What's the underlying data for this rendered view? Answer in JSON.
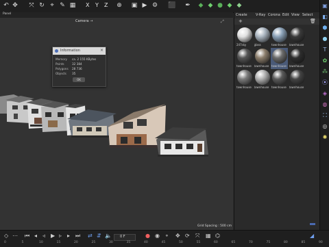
{
  "viewport": {
    "menu_label": "Panel",
    "camera_label": "Camera →",
    "grid_spacing": "Grid Spacing : 500 cm"
  },
  "toolbar": {
    "axis_x": "X",
    "axis_y": "Y",
    "axis_z": "Z"
  },
  "info_dialog": {
    "title": "Information",
    "rows": [
      {
        "label": "Memory",
        "value": "ca. 2 155 KBytes"
      },
      {
        "label": "Points",
        "value": "32 384"
      },
      {
        "label": "Polygons",
        "value": "28 736"
      },
      {
        "label": "Objects",
        "value": "35"
      }
    ],
    "ok_label": "OK"
  },
  "material_panel": {
    "menu": [
      "Create",
      "V-Ray",
      "Corona",
      "Edit",
      "View",
      "Select"
    ],
    "materials": [
      {
        "label": "247sky",
        "color": "#e0e0e0"
      },
      {
        "label": "glass",
        "color": "#a9b4bf"
      },
      {
        "label": "townhouse",
        "color": "#8aa0b6"
      },
      {
        "label": "townhouse",
        "color": "#3a3a3a"
      },
      {
        "label": "townhouse",
        "color": "#555555"
      },
      {
        "label": "townhouse",
        "color": "#8b7d6b"
      },
      {
        "label": "townhouse",
        "color": "#6b6b6b"
      },
      {
        "label": "townhouse",
        "color": "#2e2e2e"
      },
      {
        "label": "townhouse",
        "color": "#7a7a7a"
      },
      {
        "label": "townhouse",
        "color": "#b0b0b0"
      },
      {
        "label": "townhouse",
        "color": "#5a5a5a"
      },
      {
        "label": "townhouse",
        "color": "#444444"
      }
    ],
    "selected_index": 6
  },
  "timeline": {
    "frame_value": "0 F",
    "ticks": [
      "0",
      "5",
      "10",
      "15",
      "20",
      "25",
      "30",
      "35",
      "40",
      "45",
      "50",
      "55",
      "60",
      "65",
      "70",
      "75",
      "80",
      "85",
      "90"
    ]
  },
  "colors": {
    "accent": "#4a5a78",
    "viewport_bg": "#333333"
  }
}
